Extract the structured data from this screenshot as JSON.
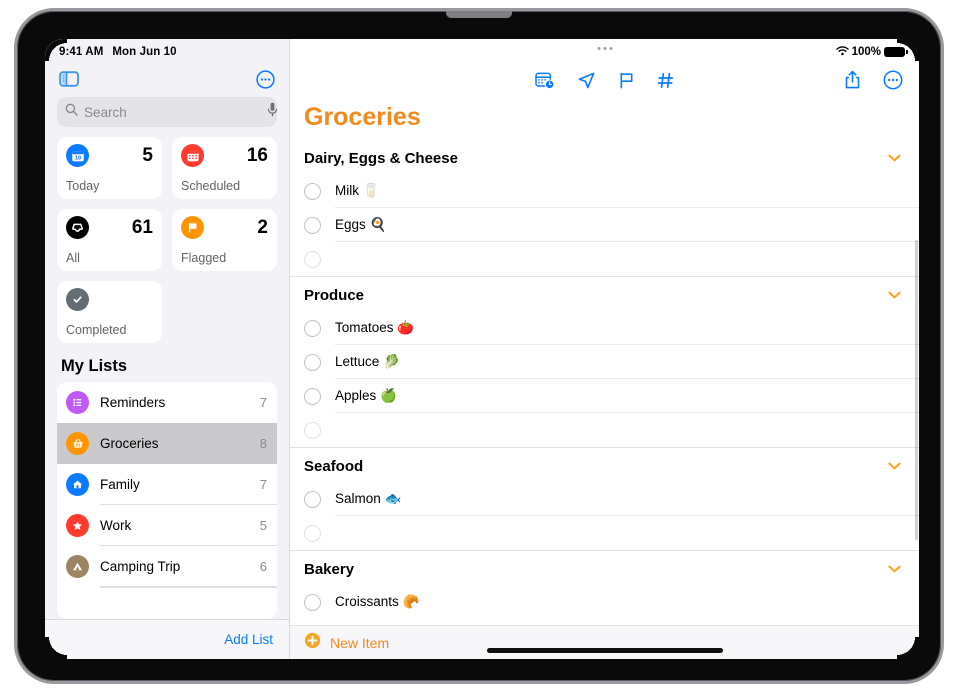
{
  "status_bar": {
    "time": "9:41 AM",
    "date": "Mon Jun 10",
    "battery_percent": "100%",
    "wifi_icon": "wifi-icon",
    "battery_icon": "battery-full-icon"
  },
  "sidebar": {
    "toggle_icon": "sidebar-toggle-icon",
    "more_icon": "more-circle-icon",
    "search": {
      "placeholder": "Search",
      "value": "",
      "search_icon": "search-icon",
      "mic_icon": "microphone-icon"
    },
    "smart_lists": [
      {
        "label": "Today",
        "count": "5",
        "icon": "calendar-day-icon",
        "color": "#0a7aff"
      },
      {
        "label": "Scheduled",
        "count": "16",
        "icon": "calendar-icon",
        "color": "#ff3b30"
      },
      {
        "label": "All",
        "count": "61",
        "icon": "inbox-tray-icon",
        "color": "#000000"
      },
      {
        "label": "Flagged",
        "count": "2",
        "icon": "flag-icon",
        "color": "#ff9500"
      },
      {
        "label": "Completed",
        "count": "",
        "icon": "checkmark-icon",
        "color": "#636d73"
      }
    ],
    "my_lists_title": "My Lists",
    "lists": [
      {
        "label": "Reminders",
        "count": "7",
        "icon": "list-bullet-icon",
        "color": "#bf5af2",
        "selected": false
      },
      {
        "label": "Groceries",
        "count": "8",
        "icon": "basket-icon",
        "color": "#ff9500",
        "selected": true
      },
      {
        "label": "Family",
        "count": "7",
        "icon": "house-icon",
        "color": "#0a7aff",
        "selected": false
      },
      {
        "label": "Work",
        "count": "5",
        "icon": "star-icon",
        "color": "#ff3b30",
        "selected": false
      },
      {
        "label": "Camping Trip",
        "count": "6",
        "icon": "tent-icon",
        "color": "#9c8463",
        "selected": false
      }
    ],
    "add_list_label": "Add List"
  },
  "main": {
    "title": "Groceries",
    "title_color": "#f08a1c",
    "toolbar_center": [
      {
        "name": "schedule-icon",
        "label": "calendar-clock-icon"
      },
      {
        "name": "location-icon",
        "label": "location-arrow-icon"
      },
      {
        "name": "flag-icon",
        "label": "flag-outline-icon"
      },
      {
        "name": "tag-icon",
        "label": "hashtag-icon"
      }
    ],
    "toolbar_right": [
      {
        "name": "share-icon",
        "label": "share-up-icon"
      },
      {
        "name": "more-icon",
        "label": "more-circle-icon"
      }
    ],
    "sections": [
      {
        "title": "Dairy, Eggs & Cheese",
        "collapse_icon": "chevron-down-icon",
        "items": [
          {
            "text": "Milk 🥛",
            "empty": false
          },
          {
            "text": "Eggs 🍳",
            "empty": false
          },
          {
            "text": "",
            "empty": true
          }
        ]
      },
      {
        "title": "Produce",
        "collapse_icon": "chevron-down-icon",
        "items": [
          {
            "text": "Tomatoes 🍅",
            "empty": false
          },
          {
            "text": "Lettuce 🥬",
            "empty": false
          },
          {
            "text": "Apples 🍏",
            "empty": false
          },
          {
            "text": "",
            "empty": true
          }
        ]
      },
      {
        "title": "Seafood",
        "collapse_icon": "chevron-down-icon",
        "items": [
          {
            "text": "Salmon 🐟",
            "empty": false
          },
          {
            "text": "",
            "empty": true
          }
        ]
      },
      {
        "title": "Bakery",
        "collapse_icon": "chevron-down-icon",
        "items": [
          {
            "text": "Croissants 🥐",
            "empty": false
          }
        ]
      }
    ],
    "new_item_label": "New Item",
    "new_item_icon": "plus-circle-icon"
  }
}
